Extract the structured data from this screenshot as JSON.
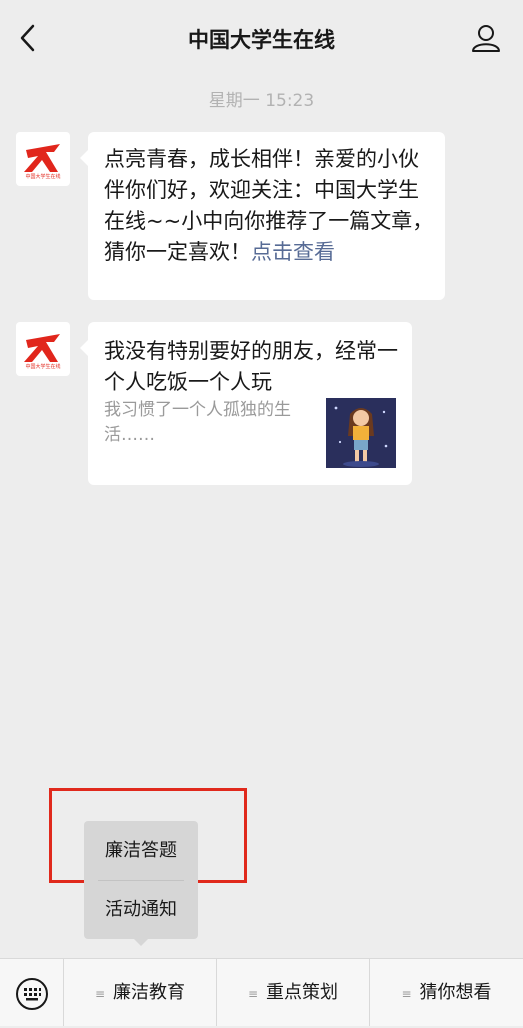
{
  "header": {
    "title": "中国大学生在线"
  },
  "timestamp": "星期一 15:23",
  "messages": [
    {
      "avatar_logo_text": "中国大学生在线",
      "text": "点亮青春，成长相伴！亲爱的小伙伴你们好，欢迎关注：中国大学生在线~~小中向你推荐了一篇文章，猜你一定喜欢！",
      "link_text": "点击查看"
    },
    {
      "avatar_logo_text": "中国大学生在线",
      "title": "我没有特别要好的朋友，经常一个人吃饭一个人玩",
      "description": "我习惯了一个人孤独的生活……"
    }
  ],
  "submenu": {
    "items": [
      "廉洁答题",
      "活动通知"
    ]
  },
  "menubar": {
    "items": [
      "廉洁教育",
      "重点策划",
      "猜你想看"
    ]
  },
  "colors": {
    "annotation": "#e0291c",
    "link": "#576b95",
    "logo": "#e1261c"
  },
  "icons": {
    "back": "chevron-left-icon",
    "profile": "user-icon",
    "keyboard": "keyboard-icon",
    "menu": "hamburger-icon"
  }
}
